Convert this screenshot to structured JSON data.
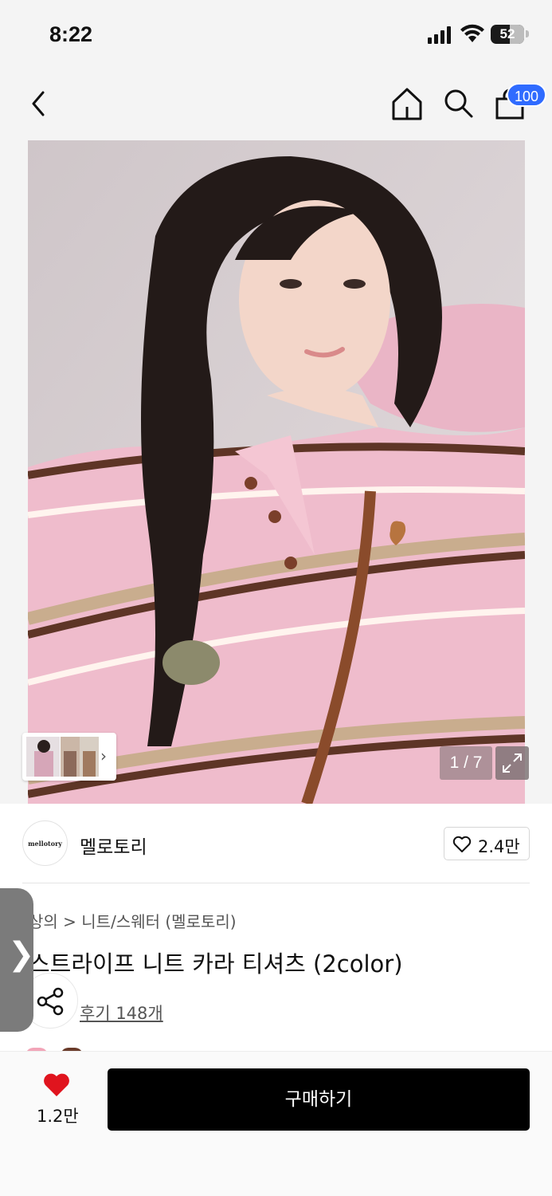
{
  "status_bar": {
    "time": "8:22",
    "battery": "52"
  },
  "header": {
    "cart_count": "100"
  },
  "gallery": {
    "counter": "1 / 7"
  },
  "brand": {
    "logo_text": "mellotory",
    "name": "멜로토리",
    "likes": "2.4만"
  },
  "product": {
    "breadcrumb": "상의 > 니트/스웨터 (멜로토리)",
    "title": "스트라이프 니트 카라 티셔츠 (2color)",
    "reviews": "후기 148개"
  },
  "bottom_bar": {
    "wish_count": "1.2만",
    "buy_label": "구매하기"
  },
  "colors": {
    "accent_blue": "#2f6bff",
    "heart_red": "#e0141e",
    "buy_bg": "#000000"
  }
}
